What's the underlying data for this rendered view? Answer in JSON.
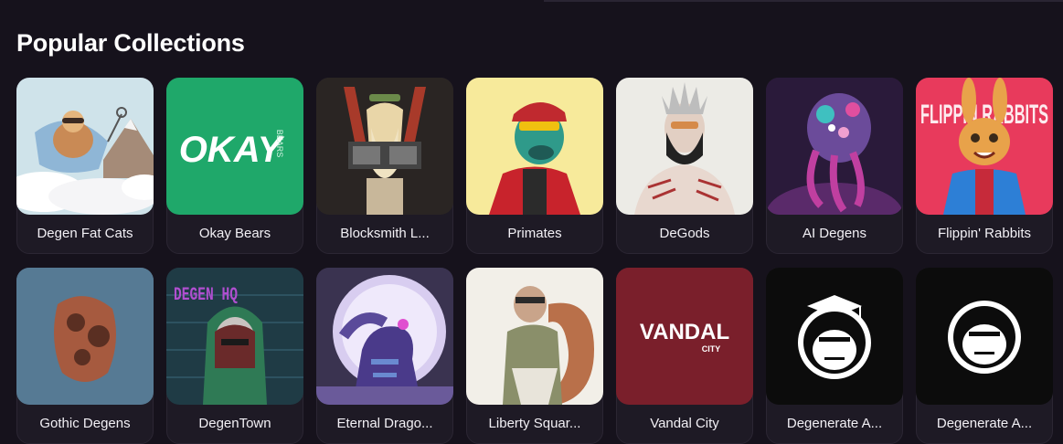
{
  "page": {
    "section_title": "Popular Collections"
  },
  "collections": [
    {
      "name": "Degen Fat Cats",
      "icon": "degen-fat-cats-artwork"
    },
    {
      "name": "Okay Bears",
      "icon": "okay-bears-logo",
      "logo_text": "OKAY",
      "logo_subtext": "BEARS"
    },
    {
      "name": "Blocksmith L...",
      "icon": "blocksmith-artwork"
    },
    {
      "name": "Primates",
      "icon": "primates-artwork"
    },
    {
      "name": "DeGods",
      "icon": "degods-artwork"
    },
    {
      "name": "AI Degens",
      "icon": "ai-degens-artwork"
    },
    {
      "name": "Flippin' Rabbits",
      "icon": "flippin-rabbits-artwork",
      "art_text": "FLIPPIN RABBITS"
    },
    {
      "name": "Gothic Degens",
      "icon": "gothic-degens-artwork"
    },
    {
      "name": "DegenTown",
      "icon": "degentown-artwork",
      "art_text": "DEGEN HQ"
    },
    {
      "name": "Eternal Drago...",
      "icon": "eternal-dragons-artwork"
    },
    {
      "name": "Liberty Squar...",
      "icon": "liberty-square-artwork"
    },
    {
      "name": "Vandal City",
      "icon": "vandal-city-logo",
      "logo_text": "VANDAL",
      "logo_subtext": "CITY"
    },
    {
      "name": "Degenerate A...",
      "icon": "degenerate-ape-graduate-logo"
    },
    {
      "name": "Degenerate A...",
      "icon": "degenerate-ape-logo"
    }
  ],
  "colors": {
    "background": "#16121c",
    "card_background": "#1e1a25",
    "okay_bears_green": "#1fa86a",
    "vandal_city_red": "#7a1f2b"
  }
}
